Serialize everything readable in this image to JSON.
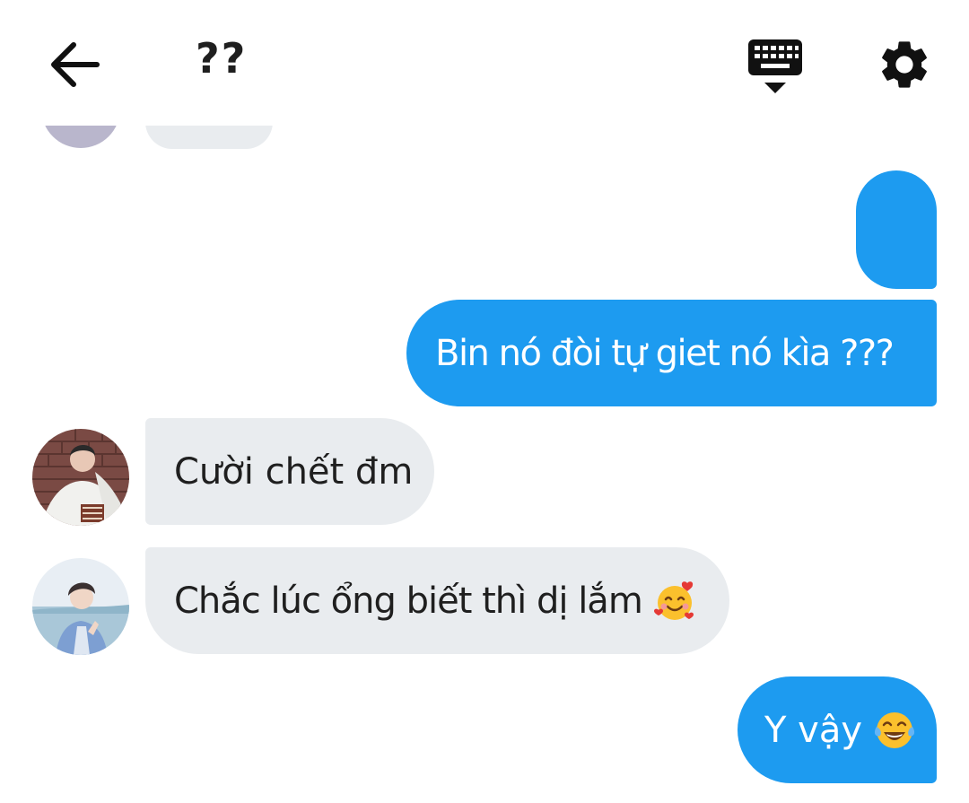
{
  "header": {
    "title": "??",
    "icons": {
      "back": "arrow-left-icon",
      "keyboard": "keyboard-hide-icon",
      "settings": "gear-icon"
    }
  },
  "messages": [
    {
      "direction": "outgoing",
      "text": ""
    },
    {
      "direction": "outgoing",
      "text": "Bin nó đòi tự giet nó kìa ???"
    },
    {
      "direction": "incoming",
      "text": "Cười chết đm",
      "avatar": "avatar-brick-wall-icon"
    },
    {
      "direction": "incoming",
      "text": "Chắc lúc ổng biết thì dị lắm",
      "emoji": "smiling-face-with-hearts-icon",
      "avatar": "avatar-beach-icon"
    },
    {
      "direction": "outgoing",
      "text": "Y vậy",
      "emoji": "face-with-tears-of-joy-icon"
    }
  ],
  "colors": {
    "outgoing_bubble": "#1d9bf0",
    "incoming_bubble": "#e9ecef",
    "text_dark": "#1f1f1f",
    "text_light": "#ffffff"
  }
}
